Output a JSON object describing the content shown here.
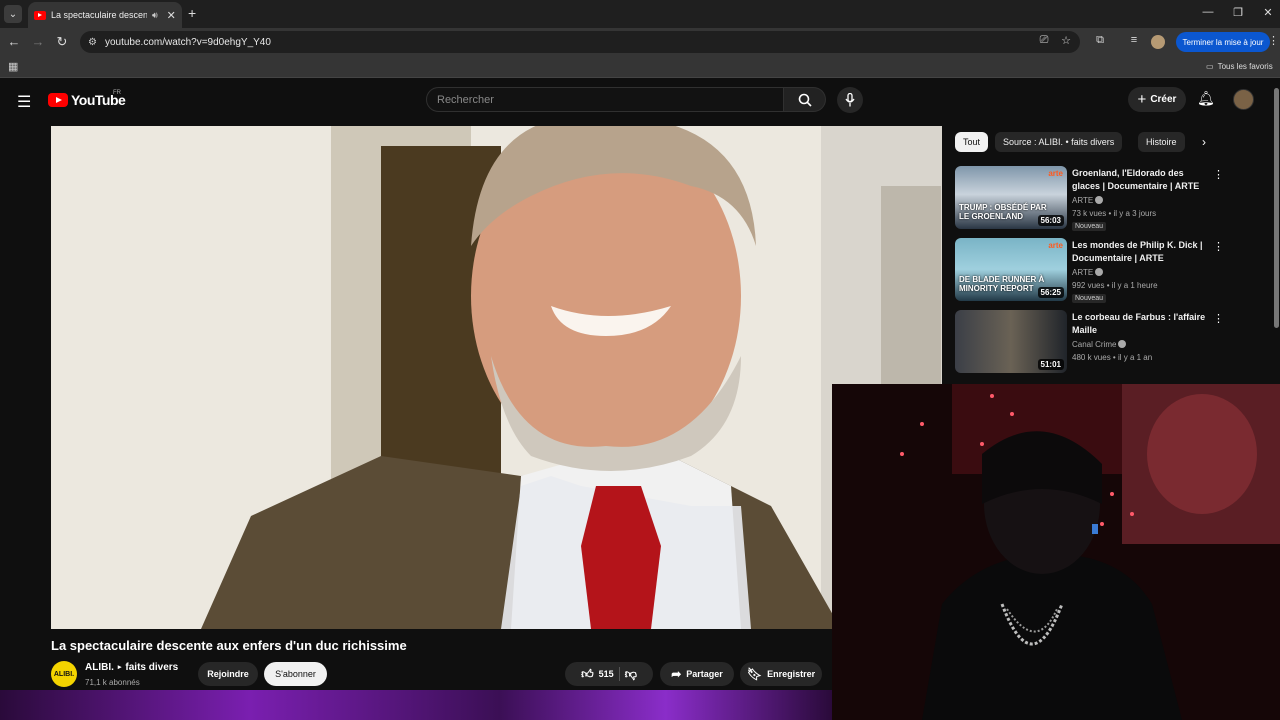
{
  "browser": {
    "tab_title": "La spectaculaire descente aux enfers d'un duc richissime",
    "url": "youtube.com/watch?v=9d0ehgY_Y40",
    "update_button": "Terminer la mise à jour",
    "favorites_label": "Tous les favoris"
  },
  "header": {
    "logo_text": "YouTube",
    "country_code": "FR",
    "search_placeholder": "Rechercher",
    "create_label": "Créer"
  },
  "video": {
    "title": "La spectaculaire descente aux enfers d'un duc richissime",
    "channel_name": "ALIBI.",
    "channel_tag": "faits divers",
    "channel_avatar_text": "ALIBI.",
    "subscribers": "71,1 k abonnés",
    "join_label": "Rejoindre",
    "subscribe_label": "S'abonner",
    "likes": "515",
    "share_label": "Partager",
    "save_label": "Enregistrer"
  },
  "sidebar": {
    "chips": [
      "Tout",
      "Source : ALIBI. • faits divers",
      "Histoire"
    ],
    "recommendations": [
      {
        "title": "Groenland, l'Eldorado des glaces | Documentaire | ARTE",
        "channel": "ARTE",
        "meta": "73 k vues • il y a 3 jours",
        "badge": "Nouveau",
        "duration": "56:03",
        "thumb_text": "TRUMP : OBSÉDÉ PAR LE GROENLAND",
        "thumb_logo": "arte"
      },
      {
        "title": "Les mondes de Philip K. Dick | Documentaire | ARTE",
        "channel": "ARTE",
        "meta": "992 vues • il y a 1 heure",
        "badge": "Nouveau",
        "duration": "56:25",
        "thumb_text": "DE BLADE RUNNER À MINORITY REPORT",
        "thumb_logo": "arte"
      },
      {
        "title": "Le corbeau de Farbus : l'affaire Maille",
        "channel": "Canal Crime",
        "meta": "480 k vues • il y a 1 an",
        "duration": "51:01"
      }
    ]
  }
}
